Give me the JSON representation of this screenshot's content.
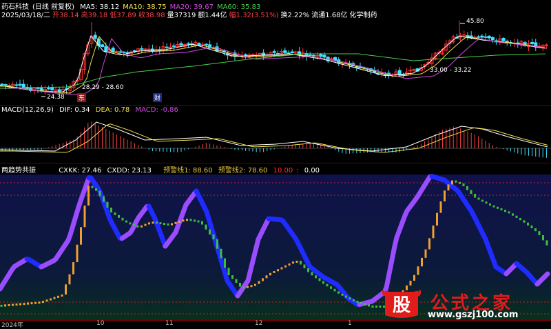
{
  "panel1": {
    "stock": "药石科技",
    "mode": "(日线 前复权)",
    "ma": [
      {
        "label": "MA5: 38.12",
        "color": "#ffffff"
      },
      {
        "label": "MA10: 38.75",
        "color": "#f5e04a"
      },
      {
        "label": "MA20: 39.67",
        "color": "#d04ae0"
      },
      {
        "label": "MA60: 35.83",
        "color": "#4ad04a"
      }
    ],
    "quote": [
      {
        "text": "2025/03/18/二",
        "color": "#ffffff"
      },
      {
        "text": "开38.14",
        "color": "#ff4040"
      },
      {
        "text": "高39.18",
        "color": "#ff4040"
      },
      {
        "text": "低37.89",
        "color": "#ff4040"
      },
      {
        "text": "收38.98",
        "color": "#ff4040"
      },
      {
        "text": "量37319",
        "color": "#ffffff"
      },
      {
        "text": "额1.44亿",
        "color": "#ffffff"
      },
      {
        "text": "幅1.32(3.51%)",
        "color": "#ff4040"
      },
      {
        "text": "换2.22%",
        "color": "#ffffff"
      },
      {
        "text": "流通1.68亿",
        "color": "#ffffff"
      },
      {
        "text": "化学制药",
        "color": "#ffffff"
      }
    ],
    "annotations": {
      "high": "45.80",
      "low": "24.38",
      "range1": "28.29 - 28.60",
      "range2": "33.00 - 33.22",
      "marker1": "东",
      "marker2": "财"
    }
  },
  "panel2": {
    "name": "MACD(12,26,9)",
    "dif": "DIF: 0.34",
    "dea": "DEA: 0.78",
    "macd": "MACD: -0.86"
  },
  "panel3": {
    "name": "两趋势共振",
    "cxkk": "CXKK: 27.46",
    "cxdd": "CXDD: 23.13",
    "warn1": "预警线1: 88.60",
    "warn2": "预警线2: 78.60",
    "v1": "10.00",
    "v2": "0.00"
  },
  "xaxis": [
    "2024年",
    "10",
    "11",
    "12",
    "1"
  ],
  "logo": {
    "badge": "股",
    "title": "公式之家",
    "url": "www.gszj100.com"
  },
  "colors": {
    "up": "#ff3030",
    "down": "#40e0ff",
    "ma5": "#ffffff",
    "ma10": "#f5e04a",
    "ma20": "#d04ae0",
    "ma60": "#4ad04a",
    "purple": "#9a4cff",
    "blue": "#1f2bff",
    "orange": "#f0a030",
    "green": "#3cc03c",
    "warn": "#cc2222"
  }
}
